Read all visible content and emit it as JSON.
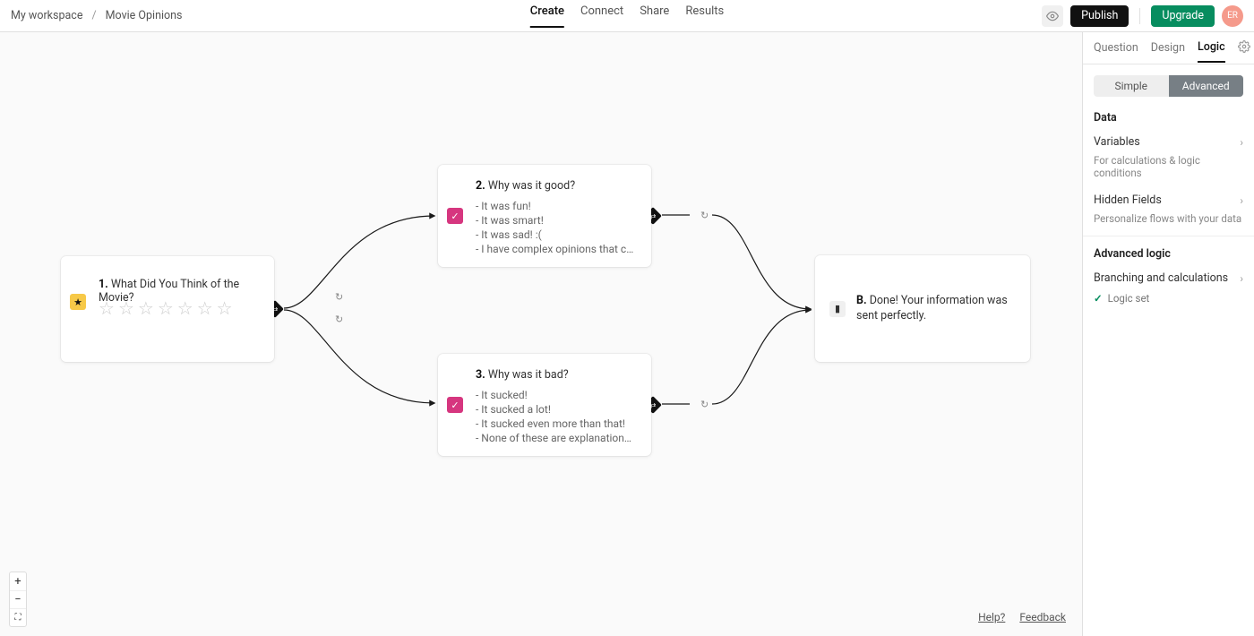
{
  "breadcrumb": {
    "workspace": "My workspace",
    "project": "Movie Opinions"
  },
  "nav": {
    "create": "Create",
    "connect": "Connect",
    "share": "Share",
    "results": "Results"
  },
  "header": {
    "publish": "Publish",
    "upgrade": "Upgrade",
    "avatar": "ER"
  },
  "sidebar": {
    "tabs": {
      "question": "Question",
      "design": "Design",
      "logic": "Logic"
    },
    "toggle": {
      "simple": "Simple",
      "advanced": "Advanced"
    },
    "data_title": "Data",
    "variables": {
      "label": "Variables",
      "sub": "For calculations & logic conditions"
    },
    "hidden": {
      "label": "Hidden Fields",
      "sub": "Personalize flows with your data"
    },
    "adv_title": "Advanced logic",
    "branching": {
      "label": "Branching and calculations",
      "status": "Logic set"
    }
  },
  "cards": {
    "q1": {
      "num": "1.",
      "title": "What Did You Think of the Movie?"
    },
    "q2": {
      "num": "2.",
      "title": "Why was it good?",
      "opts": [
        "- It was fun!",
        "- It was smart!",
        "- It was sad! :(",
        "- I have complex opinions that can't …"
      ]
    },
    "q3": {
      "num": "3.",
      "title": "Why was it bad?",
      "opts": [
        "- It sucked!",
        "- It sucked a lot!",
        "- It sucked even more than that!",
        "- None of these are explanations as t…"
      ]
    },
    "end": {
      "num": "B.",
      "title": "Done! Your information was sent perfectly."
    }
  },
  "footer": {
    "help": "Help?",
    "feedback": "Feedback"
  },
  "zoom": {
    "in": "+",
    "out": "−",
    "full": "⛶"
  }
}
